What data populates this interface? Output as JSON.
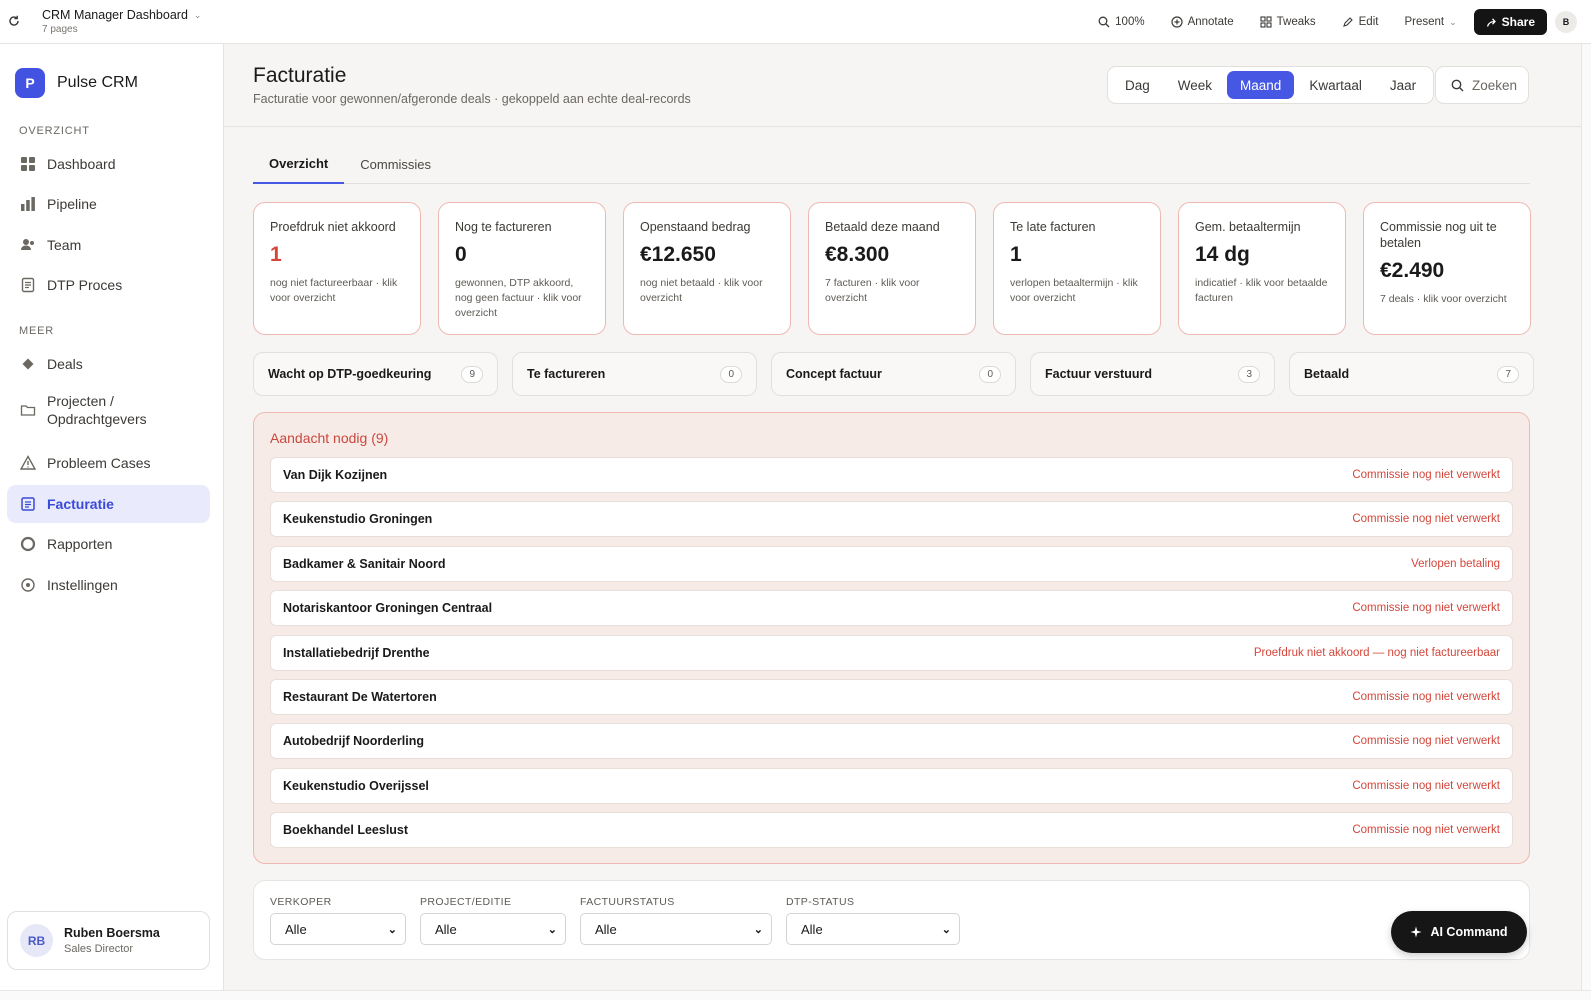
{
  "topbar": {
    "doc_title": "CRM Manager Dashboard",
    "doc_pages": "7 pages",
    "zoom": "100%",
    "annotate": "Annotate",
    "tweaks": "Tweaks",
    "edit": "Edit",
    "present": "Present",
    "share": "Share",
    "avatar": "B"
  },
  "sidebar": {
    "brand_letter": "P",
    "brand_name": "Pulse CRM",
    "section_overview": "OVERZICHT",
    "section_more": "MEER",
    "items": [
      {
        "label": "Dashboard",
        "icon": "grid-icon"
      },
      {
        "label": "Pipeline",
        "icon": "bar-chart-icon"
      },
      {
        "label": "Team",
        "icon": "users-icon"
      },
      {
        "label": "DTP Proces",
        "icon": "document-icon"
      },
      {
        "label": "Deals",
        "icon": "diamond-icon"
      },
      {
        "label": "Projecten / Opdrachtgevers",
        "icon": "folder-icon"
      },
      {
        "label": "Probleem Cases",
        "icon": "warning-icon"
      },
      {
        "label": "Facturatie",
        "icon": "invoice-icon"
      },
      {
        "label": "Rapporten",
        "icon": "circle-icon"
      },
      {
        "label": "Instellingen",
        "icon": "settings-icon"
      }
    ],
    "user": {
      "initials": "RB",
      "name": "Ruben Boersma",
      "role": "Sales Director"
    }
  },
  "header": {
    "title": "Facturatie",
    "subtitle": "Facturatie voor gewonnen/afgeronde deals · gekoppeld aan echte deal-records",
    "periods": [
      "Dag",
      "Week",
      "Maand",
      "Kwartaal",
      "Jaar"
    ],
    "active_period": "Maand",
    "search": "Zoeken"
  },
  "tabs": [
    "Overzicht",
    "Commissies"
  ],
  "kpis": [
    {
      "label": "Proefdruk niet akkoord",
      "value": "1",
      "note": "nog niet factureerbaar · klik voor overzicht",
      "red": true
    },
    {
      "label": "Nog te factureren",
      "value": "0",
      "note": "gewonnen, DTP akkoord, nog geen factuur · klik voor overzicht",
      "red": false
    },
    {
      "label": "Openstaand bedrag",
      "value": "€12.650",
      "note": "nog niet betaald · klik voor overzicht",
      "red": false
    },
    {
      "label": "Betaald deze maand",
      "value": "€8.300",
      "note": "7 facturen · klik voor overzicht",
      "red": false
    },
    {
      "label": "Te late facturen",
      "value": "1",
      "note": "verlopen betaaltermijn · klik voor overzicht",
      "red": false
    },
    {
      "label": "Gem. betaaltermijn",
      "value": "14 dg",
      "note": "indicatief · klik voor betaalde facturen",
      "red": false
    },
    {
      "label": "Commissie nog uit te betalen",
      "value": "€2.490",
      "note": "7 deals · klik voor overzicht",
      "red": false
    }
  ],
  "stages": [
    {
      "label": "Wacht op DTP-goedkeuring",
      "count": "9"
    },
    {
      "label": "Te factureren",
      "count": "0"
    },
    {
      "label": "Concept factuur",
      "count": "0"
    },
    {
      "label": "Factuur verstuurd",
      "count": "3"
    },
    {
      "label": "Betaald",
      "count": "7"
    }
  ],
  "attention": {
    "title": "Aandacht nodig (9)",
    "rows": [
      {
        "name": "Van Dijk Kozijnen",
        "status": "Commissie nog niet verwerkt"
      },
      {
        "name": "Keukenstudio Groningen",
        "status": "Commissie nog niet verwerkt"
      },
      {
        "name": "Badkamer & Sanitair Noord",
        "status": "Verlopen betaling"
      },
      {
        "name": "Notariskantoor Groningen Centraal",
        "status": "Commissie nog niet verwerkt"
      },
      {
        "name": "Installatiebedrijf Drenthe",
        "status": "Proefdruk niet akkoord — nog niet factureerbaar"
      },
      {
        "name": "Restaurant De Watertoren",
        "status": "Commissie nog niet verwerkt"
      },
      {
        "name": "Autobedrijf Noorderling",
        "status": "Commissie nog niet verwerkt"
      },
      {
        "name": "Keukenstudio Overijssel",
        "status": "Commissie nog niet verwerkt"
      },
      {
        "name": "Boekhandel Leeslust",
        "status": "Commissie nog niet verwerkt"
      }
    ]
  },
  "filters": [
    {
      "label": "VERKOPER",
      "value": "Alle"
    },
    {
      "label": "PROJECT/EDITIE",
      "value": "Alle"
    },
    {
      "label": "FACTUURSTATUS",
      "value": "Alle"
    },
    {
      "label": "DTP-STATUS",
      "value": "Alle"
    }
  ],
  "ai_command": "AI Command",
  "colors": {
    "accent": "#4557e3",
    "alert": "#d5463a",
    "alert_border": "#efb9b3",
    "alert_bg": "#f7ebe8"
  }
}
